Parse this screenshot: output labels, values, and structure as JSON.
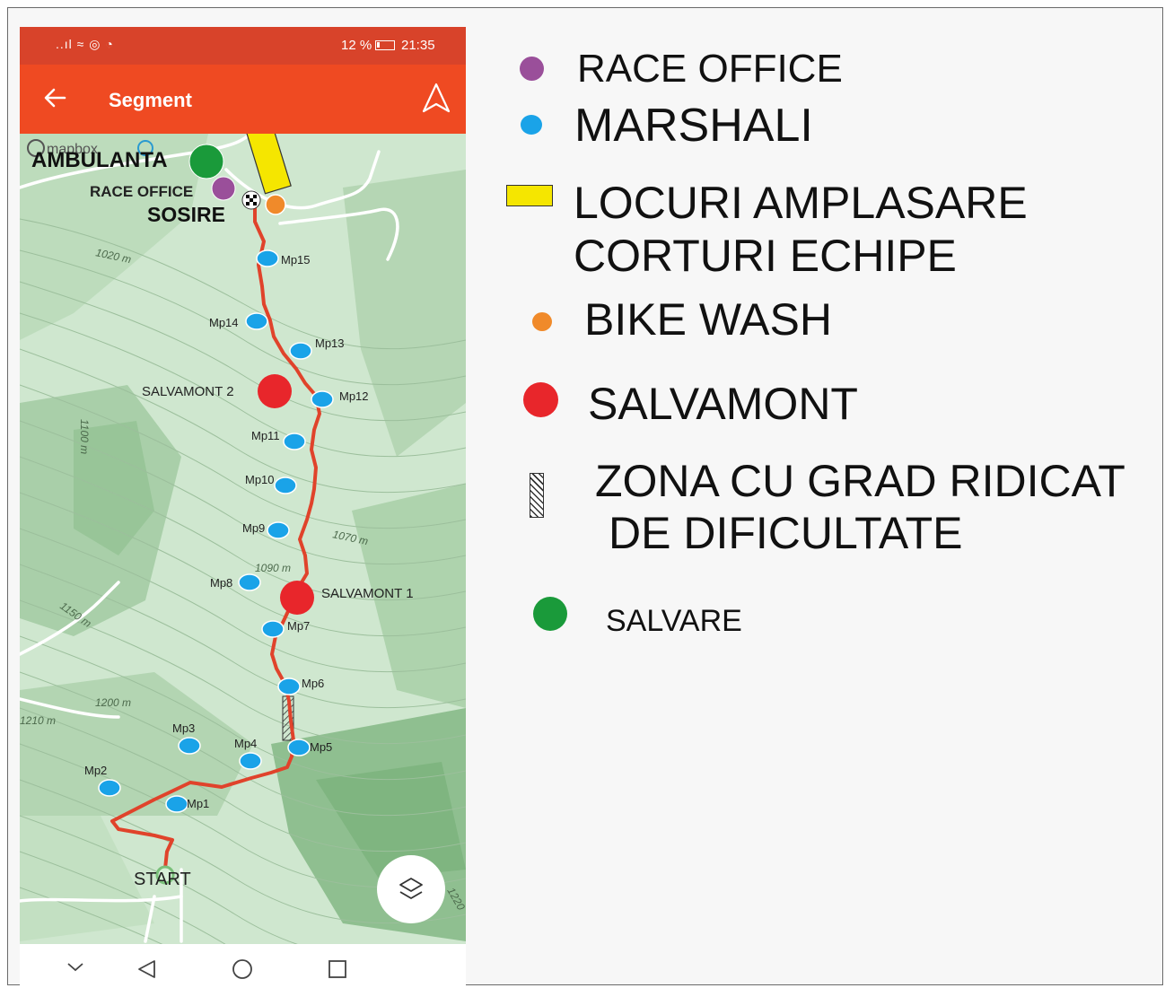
{
  "status_bar": {
    "icons": "..ıl ≈ ◎ ◔",
    "battery": "12 %",
    "time": "21:35"
  },
  "app_bar": {
    "title": "Segment"
  },
  "map": {
    "attribution": "mapbox",
    "start_label": "START",
    "finish_label": "SOSIRE",
    "ambulance_label": "AMBULANTA",
    "race_office_label": "RACE OFFICE",
    "salvamont_labels": [
      "SALVAMONT 2",
      "SALVAMONT 1"
    ],
    "marshal_points": [
      "Mp1",
      "Mp2",
      "Mp3",
      "Mp4",
      "Mp5",
      "Mp6",
      "Mp7",
      "Mp8",
      "Mp9",
      "Mp10",
      "Mp11",
      "Mp12",
      "Mp13",
      "Mp14",
      "Mp15"
    ],
    "elevation_labels": [
      "1020 m",
      "1100 m",
      "1070 m",
      "1090 m",
      "1150 m",
      "1200 m",
      "1210 m",
      "1220"
    ],
    "colors": {
      "route": "#e0432b",
      "marshal": "#1aa3e8",
      "race_office": "#9a4f9a",
      "tents": "#f5e600",
      "bike_wash": "#f08a2a",
      "salvamont": "#e8262b",
      "ambulance": "#1a9a3a",
      "map_bg": "#cfe7cf"
    }
  },
  "legend": {
    "race_office": "RACE OFFICE",
    "marshali": "MARSHALI",
    "tents_line1": "LOCURI AMPLASARE",
    "tents_line2": "CORTURI ECHIPE",
    "bike_wash": "BIKE WASH",
    "salvamont": "SALVAMONT",
    "zone_line1": "ZONA CU GRAD RIDICAT",
    "zone_line2": "DE DIFICULTATE",
    "salvare": "SALVARE"
  }
}
